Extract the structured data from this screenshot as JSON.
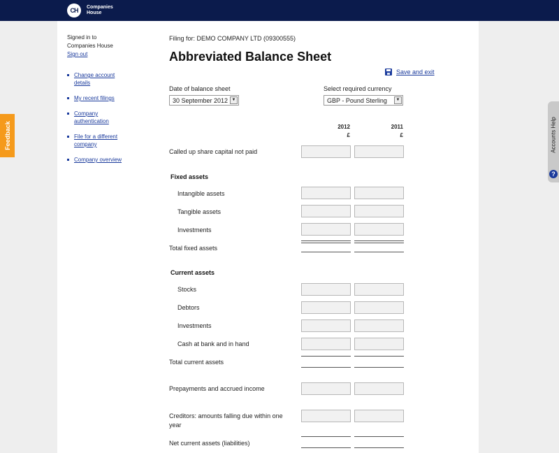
{
  "header": {
    "logo_mark": "CH",
    "logo_line1": "Companies",
    "logo_line2": "House"
  },
  "sidebar": {
    "signed_in_line1": "Signed in to",
    "signed_in_line2": "Companies House",
    "sign_out": "Sign out",
    "links": [
      {
        "line1": "Change account",
        "line2": "details"
      },
      {
        "line1": "My recent filings",
        "line2": ""
      },
      {
        "line1": "Company",
        "line2": "authentication"
      },
      {
        "line1": "File for a different",
        "line2": "company"
      },
      {
        "line1": "Company overview",
        "line2": ""
      }
    ]
  },
  "main": {
    "filing_for": "Filing for: DEMO COMPANY LTD (09300555)",
    "title": "Abbreviated Balance Sheet",
    "save_exit": "Save and exit",
    "date_label": "Date of balance sheet",
    "date_value": "30 September 2012",
    "currency_label": "Select required currency",
    "currency_value": "GBP - Pound Sterling",
    "col_year1": "2012",
    "col_year2": "2011",
    "col_unit": "£"
  },
  "rows": {
    "called_up": "Called up share capital not paid",
    "fixed_assets": "Fixed assets",
    "intangible": "Intangible assets",
    "tangible": "Tangible assets",
    "investments_fixed": "Investments",
    "total_fixed": "Total fixed assets",
    "current_assets": "Current assets",
    "stocks": "Stocks",
    "debtors": "Debtors",
    "investments_current": "Investments",
    "cash": "Cash at bank and in hand",
    "total_current": "Total current assets",
    "prepayments": "Prepayments and accrued income",
    "creditors_line1": "Creditors: amounts falling due within one",
    "creditors_line2": "year",
    "net_current": "Net current assets (liabilities)"
  },
  "side_tabs": {
    "feedback": "Feedback",
    "accounts_help": "Accounts Help",
    "help_icon": "?"
  },
  "icons": {
    "save": "floppy-disk-icon",
    "dropdown": "chevron-down-icon",
    "help": "question-icon"
  },
  "colors": {
    "header_bg": "#0b1b4c",
    "link": "#1a3a9c",
    "feedback_bg": "#f59a1b"
  }
}
